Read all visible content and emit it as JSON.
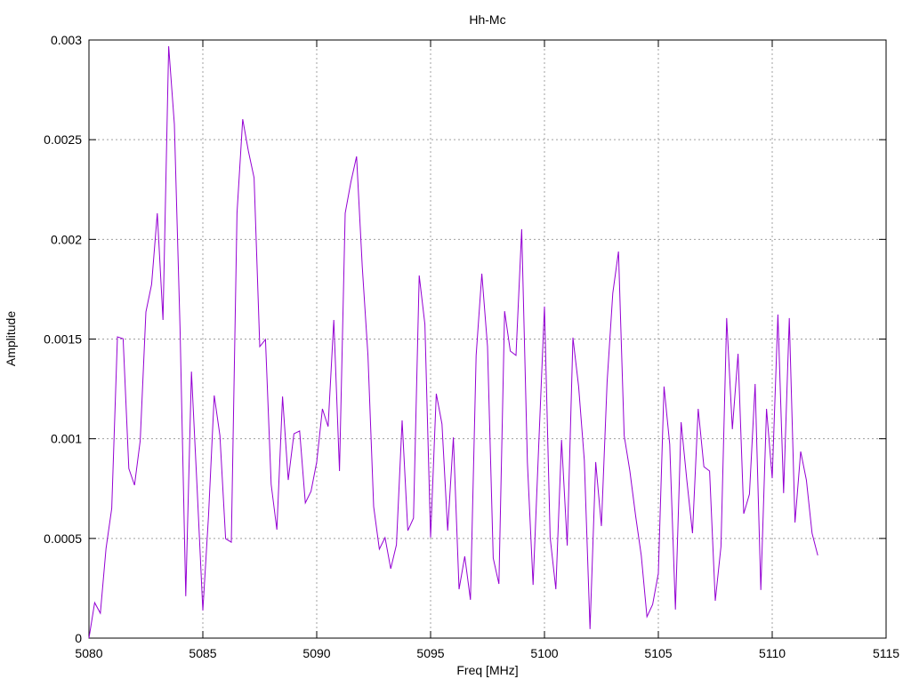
{
  "chart_data": {
    "type": "line",
    "title": "Hh-Mc",
    "xlabel": "Freq [MHz]",
    "ylabel": "Amplitude",
    "xlim": [
      5080,
      5115
    ],
    "ylim": [
      0,
      0.003
    ],
    "xticks": [
      "5080",
      "5085",
      "5090",
      "5095",
      "5100",
      "5105",
      "5110",
      "5115"
    ],
    "xtick_values": [
      5080,
      5085,
      5090,
      5095,
      5100,
      5105,
      5110,
      5115
    ],
    "yticks": [
      "0",
      "0.0005",
      "0.001",
      "0.0015",
      "0.002",
      "0.0025",
      "0.003"
    ],
    "ytick_values": [
      0,
      0.0005,
      0.001,
      0.0015,
      0.002,
      0.0025,
      0.003
    ],
    "grid": true,
    "legend": "none",
    "series": [
      {
        "name": "Hh-Mc",
        "color": "#9400d3",
        "x_start": 5080,
        "x_step": 0.25,
        "values": [
          0,
          0.000178,
          0.000125,
          0.00045,
          0.000651,
          0.001511,
          0.001502,
          0.000851,
          0.000767,
          0.00099,
          0.001636,
          0.001774,
          0.002131,
          0.001596,
          0.002969,
          0.002577,
          0.001551,
          0.00021,
          0.001337,
          0.000749,
          0.000138,
          0.000615,
          0.001217,
          0.001016,
          0.000499,
          0.000481,
          0.002131,
          0.002603,
          0.002443,
          0.002309,
          0.001462,
          0.001498,
          0.000771,
          0.000544,
          0.001212,
          0.000793,
          0.001025,
          0.001039,
          0.000678,
          0.000736,
          0.000883,
          0.00115,
          0.001061,
          0.001596,
          0.000838,
          0.002131,
          0.002287,
          0.002416,
          0.001863,
          0.001418,
          0.00066,
          0.000446,
          0.000504,
          0.000348,
          0.000468,
          0.001092,
          0.000539,
          0.000602,
          0.001819,
          0.001574,
          0.000504,
          0.001226,
          0.001074,
          0.000539,
          0.001007,
          0.000245,
          0.00041,
          0.000192,
          0.001418,
          0.001828,
          0.001462,
          0.000401,
          0.000272,
          0.00164,
          0.00144,
          0.001418,
          0.002051,
          0.000883,
          0.000267,
          0.000972,
          0.001663,
          0.000504,
          0.000245,
          0.000994,
          0.000464,
          0.001507,
          0.001262,
          0.000892,
          4.5e-05,
          0.000883,
          0.000562,
          0.001284,
          0.00173,
          0.001939,
          0.001016,
          0.000838,
          0.000615,
          0.000415,
          0.000107,
          0.000169,
          0.000325,
          0.001262,
          0.000972,
          0.000143,
          0.001083,
          0.000793,
          0.000526,
          0.00115,
          0.00086,
          0.000838,
          0.000187,
          0.000459,
          0.001605,
          0.001048,
          0.001426,
          0.000624,
          0.000722,
          0.001275,
          0.000241,
          0.00115,
          0.000802,
          0.001623,
          0.000727,
          0.001605,
          0.00058,
          0.000936,
          0.000793,
          0.000526,
          0.000415
        ]
      }
    ]
  }
}
